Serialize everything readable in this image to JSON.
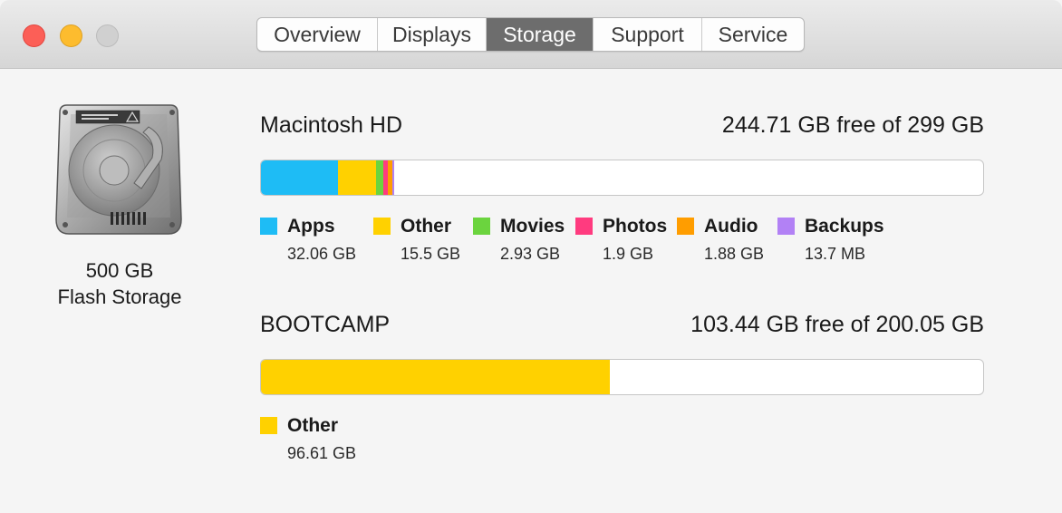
{
  "window": {
    "tabs": [
      {
        "label": "Overview"
      },
      {
        "label": "Displays"
      },
      {
        "label": "Storage"
      },
      {
        "label": "Support"
      },
      {
        "label": "Service"
      }
    ],
    "active_tab": "Storage"
  },
  "drive": {
    "icon": "hard-drive-icon",
    "capacity": "500 GB",
    "type": "Flash Storage"
  },
  "volumes": [
    {
      "name": "Macintosh HD",
      "free_text": "244.71 GB free of 299 GB",
      "categories": [
        {
          "label": "Apps",
          "size": "32.06 GB",
          "color": "#1ebcf5"
        },
        {
          "label": "Other",
          "size": "15.5 GB",
          "color": "#ffd100"
        },
        {
          "label": "Movies",
          "size": "2.93 GB",
          "color": "#6bd43e"
        },
        {
          "label": "Photos",
          "size": "1.9 GB",
          "color": "#ff3b7f"
        },
        {
          "label": "Audio",
          "size": "1.88 GB",
          "color": "#ff9d00"
        },
        {
          "label": "Backups",
          "size": "13.7 MB",
          "color": "#b281f5"
        }
      ]
    },
    {
      "name": "BOOTCAMP",
      "free_text": "103.44 GB free of 200.05 GB",
      "categories": [
        {
          "label": "Other",
          "size": "96.61 GB",
          "color": "#ffd100"
        }
      ]
    }
  ],
  "bar_fill": {
    "total_gb": [
      299,
      200.05
    ],
    "used_gb": [
      [
        32.06,
        15.5,
        2.93,
        1.9,
        1.88,
        0.0137
      ],
      [
        96.61
      ]
    ]
  }
}
